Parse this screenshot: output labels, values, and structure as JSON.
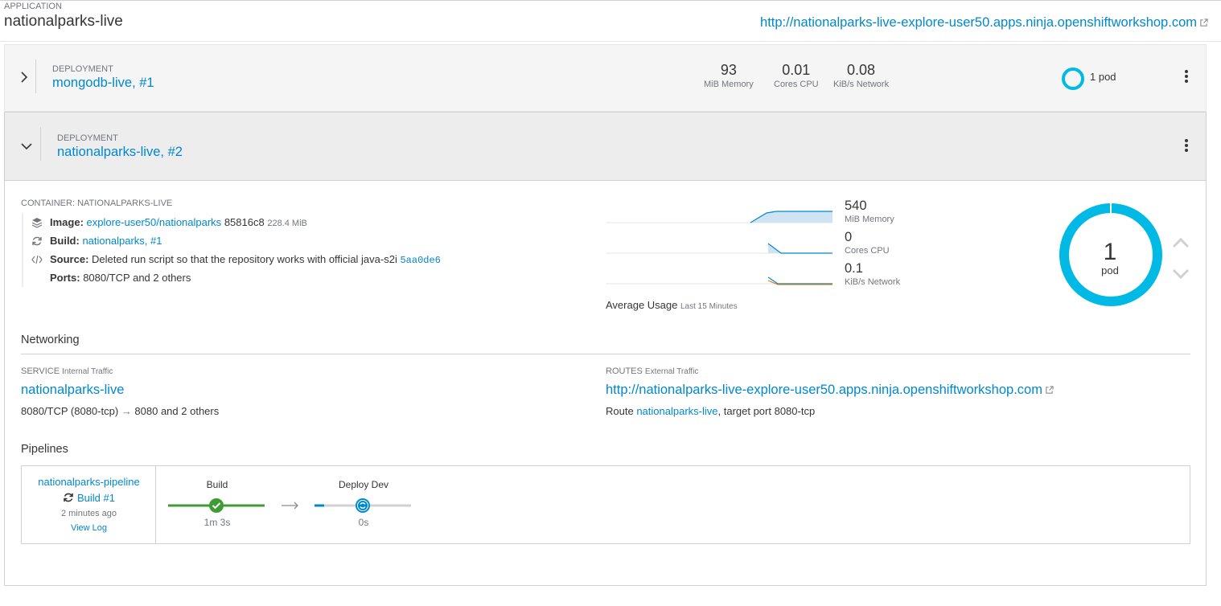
{
  "application": {
    "label": "APPLICATION",
    "name": "nationalparks-live",
    "url": "http://nationalparks-live-explore-user50.apps.ninja.openshiftworkshop.com"
  },
  "deployments": [
    {
      "label": "DEPLOYMENT",
      "name": "mongodb-live",
      "sep": ",",
      "revision": "#1",
      "metrics": [
        {
          "value": "93",
          "label": "MiB Memory"
        },
        {
          "value": "0.01",
          "label": "Cores CPU"
        },
        {
          "value": "0.08",
          "label": "KiB/s Network"
        }
      ],
      "pods": "1 pod"
    },
    {
      "label": "DEPLOYMENT",
      "name": "nationalparks-live",
      "sep": ",",
      "revision": "#2"
    }
  ],
  "container": {
    "title": "CONTAINER: NATIONALPARKS-LIVE",
    "image_label": "Image:",
    "image_link": "explore-user50/nationalparks",
    "image_hash": "85816c8",
    "image_size": "228.4 MiB",
    "build_label": "Build:",
    "build_link": "nationalparks",
    "build_sep": ",",
    "build_num": "#1",
    "source_label": "Source:",
    "source_text": "Deleted run script so that the repository works with official java-s2i",
    "source_commit": "5aa0de6",
    "ports_label": "Ports:",
    "ports_text": "8080/TCP and 2 others"
  },
  "usage": {
    "memory": {
      "value": "540",
      "label": "MiB Memory"
    },
    "cpu": {
      "value": "0",
      "label": "Cores CPU"
    },
    "network": {
      "value": "0.1",
      "label": "KiB/s Network"
    },
    "avg_label": "Average Usage",
    "avg_range": "Last 15 Minutes"
  },
  "pods": {
    "count": "1",
    "label": "pod"
  },
  "networking": {
    "title": "Networking",
    "service_cap": "SERVICE",
    "service_sub": "Internal Traffic",
    "service_name": "nationalparks-live",
    "service_ports_a": "8080/TCP (8080-tcp)",
    "service_ports_b": "8080 and 2 others",
    "routes_cap": "ROUTES",
    "routes_sub": "External Traffic",
    "route_url": "http://nationalparks-live-explore-user50.apps.ninja.openshiftworkshop.com",
    "route_prefix": "Route",
    "route_link": "nationalparks-live",
    "route_suffix": ", target port 8080-tcp"
  },
  "pipelines": {
    "title": "Pipelines",
    "name": "nationalparks-pipeline",
    "build": "Build #1",
    "ago": "2 minutes ago",
    "view_log": "View Log",
    "stages": [
      {
        "name": "Build",
        "time": "1m 3s",
        "status": "success",
        "progress": 1.0
      },
      {
        "name": "Deploy Dev",
        "time": "0s",
        "status": "running",
        "progress": 0.1
      }
    ]
  },
  "colors": {
    "link": "#0088ce",
    "pod": "#00b9e4",
    "success": "#3f9c35",
    "cpu_line": "#ec7a08"
  }
}
